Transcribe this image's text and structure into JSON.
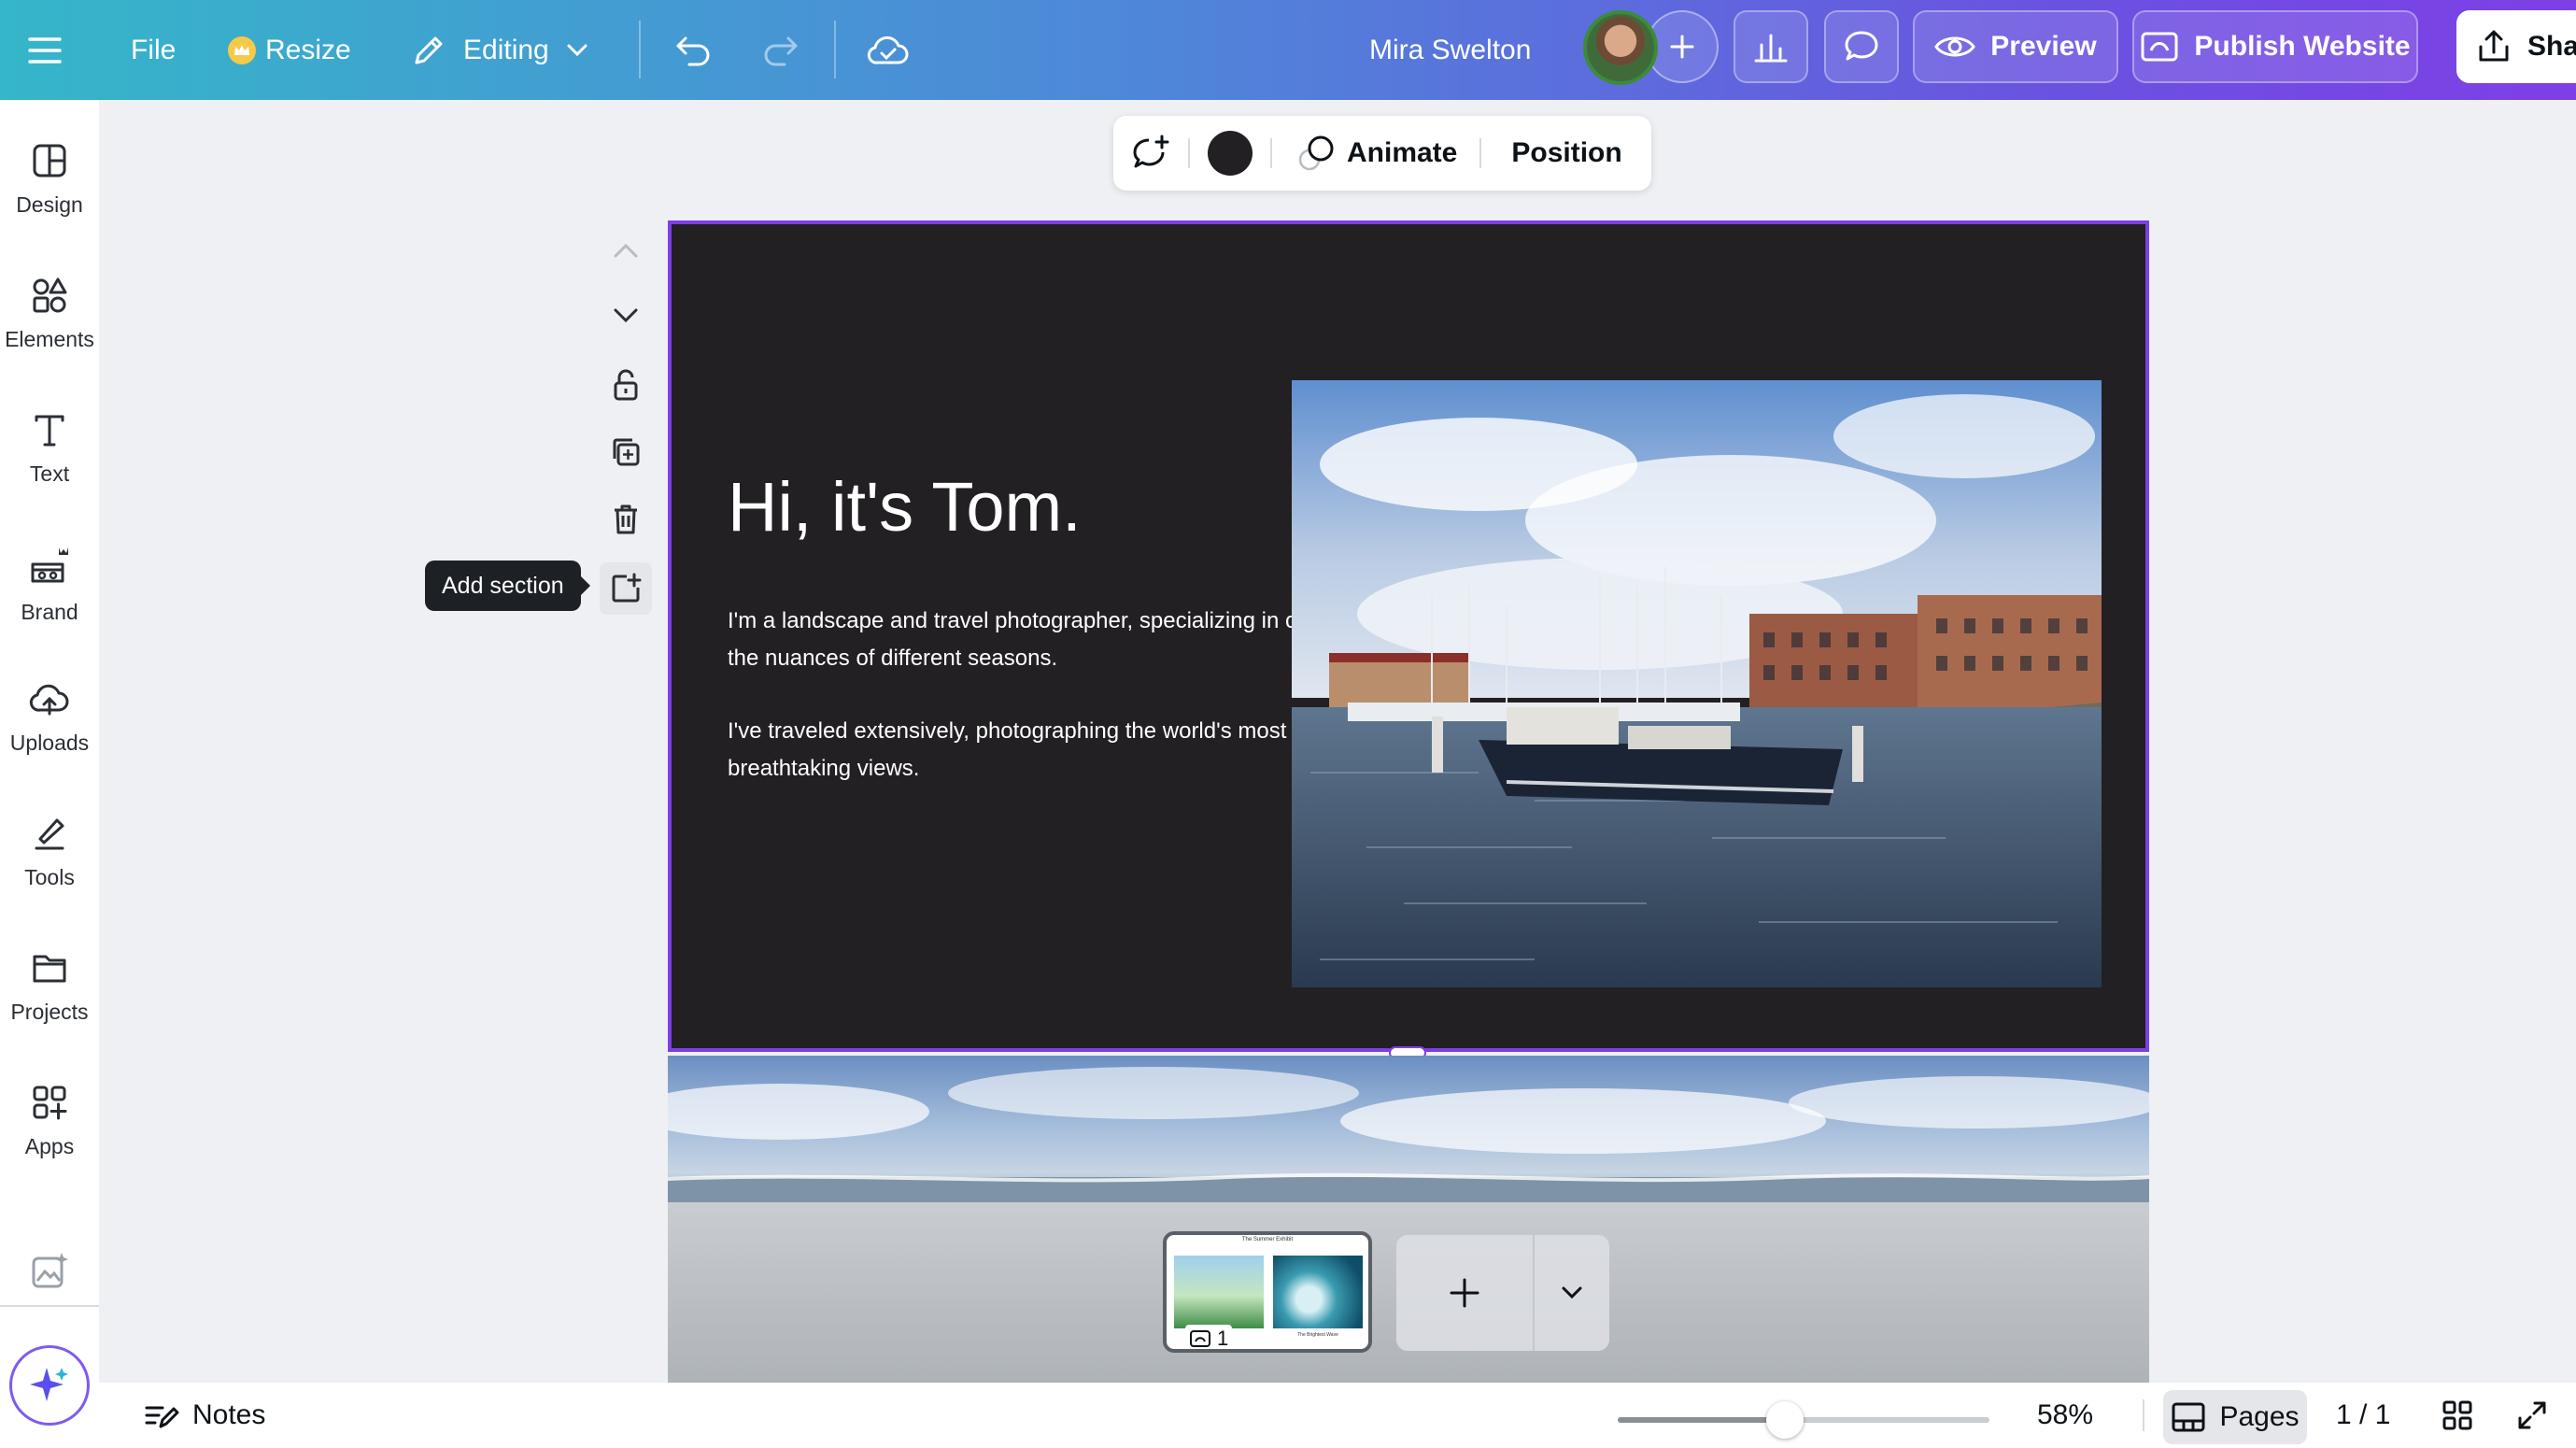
{
  "topbar": {
    "file_label": "File",
    "resize_label": "Resize",
    "editing_label": "Editing",
    "user_name": "Mira Swelton",
    "preview_label": "Preview",
    "publish_label": "Publish Website",
    "share_label": "Sha"
  },
  "sidebar": {
    "items": [
      {
        "label": "Design",
        "icon": "design-icon"
      },
      {
        "label": "Elements",
        "icon": "elements-icon"
      },
      {
        "label": "Text",
        "icon": "text-icon"
      },
      {
        "label": "Brand",
        "icon": "brand-icon"
      },
      {
        "label": "Uploads",
        "icon": "uploads-icon"
      },
      {
        "label": "Tools",
        "icon": "tools-icon"
      },
      {
        "label": "Projects",
        "icon": "projects-icon"
      },
      {
        "label": "Apps",
        "icon": "apps-icon"
      }
    ]
  },
  "context_toolbar": {
    "animate_label": "Animate",
    "position_label": "Position",
    "color": "#222022"
  },
  "canvas_controls": {
    "tooltip": "Add section"
  },
  "page": {
    "heading": "Hi, it's Tom.",
    "para1": "I'm a landscape and travel photographer, specializing in capturing the nuances of different seasons.",
    "para2": "I've traveled extensively, photographing the world's most breathtaking views.",
    "background": "#222022",
    "selection_color": "#7b3fe4"
  },
  "filmstrip": {
    "thumb_title": "The Summer Exhibit",
    "thumb_caption": "The Brightest Wave",
    "thumb_page_number": "1"
  },
  "bottombar": {
    "notes_label": "Notes",
    "zoom_label": "58%",
    "zoom_fraction": 0.45,
    "pages_label": "Pages",
    "page_count": "1 / 1"
  }
}
